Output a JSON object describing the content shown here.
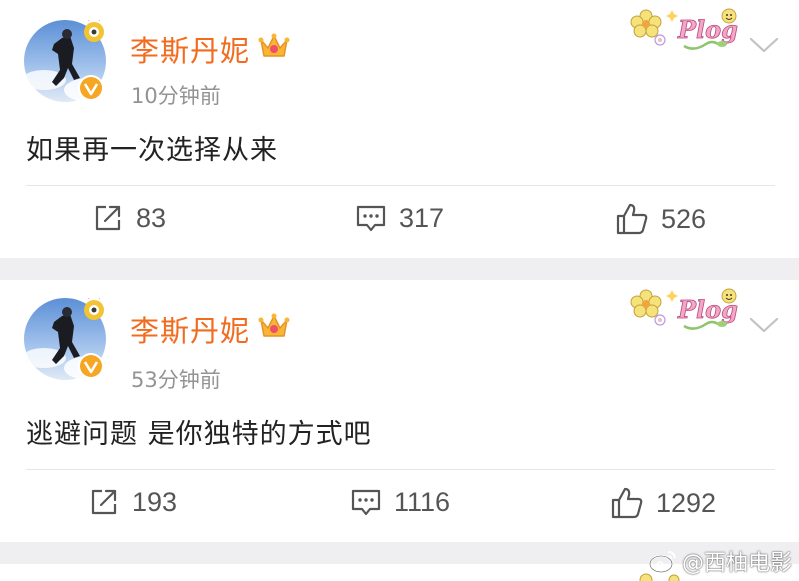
{
  "posts": [
    {
      "username": "李斯丹妮",
      "timestamp": "10分钟前",
      "text": "如果再一次选择从来",
      "reposts": "83",
      "comments": "317",
      "likes": "526",
      "badge_text": "Plog"
    },
    {
      "username": "李斯丹妮",
      "timestamp": "53分钟前",
      "text": "逃避问题 是你独特的方式吧",
      "reposts": "193",
      "comments": "1116",
      "likes": "1292",
      "badge_text": "Plog"
    }
  ],
  "watermark": {
    "text": "@西柚电影"
  },
  "icons": {
    "repost": "repost-icon",
    "comment": "comment-icon",
    "like": "like-icon",
    "crown": "crown-icon",
    "verified": "verified-badge-icon",
    "more": "chevron-down-icon"
  },
  "colors": {
    "username": "#f26b1f",
    "timestamp": "#939393",
    "text": "#222222",
    "action": "#555555",
    "background": "#efeff1",
    "verified": "#f5a623"
  }
}
